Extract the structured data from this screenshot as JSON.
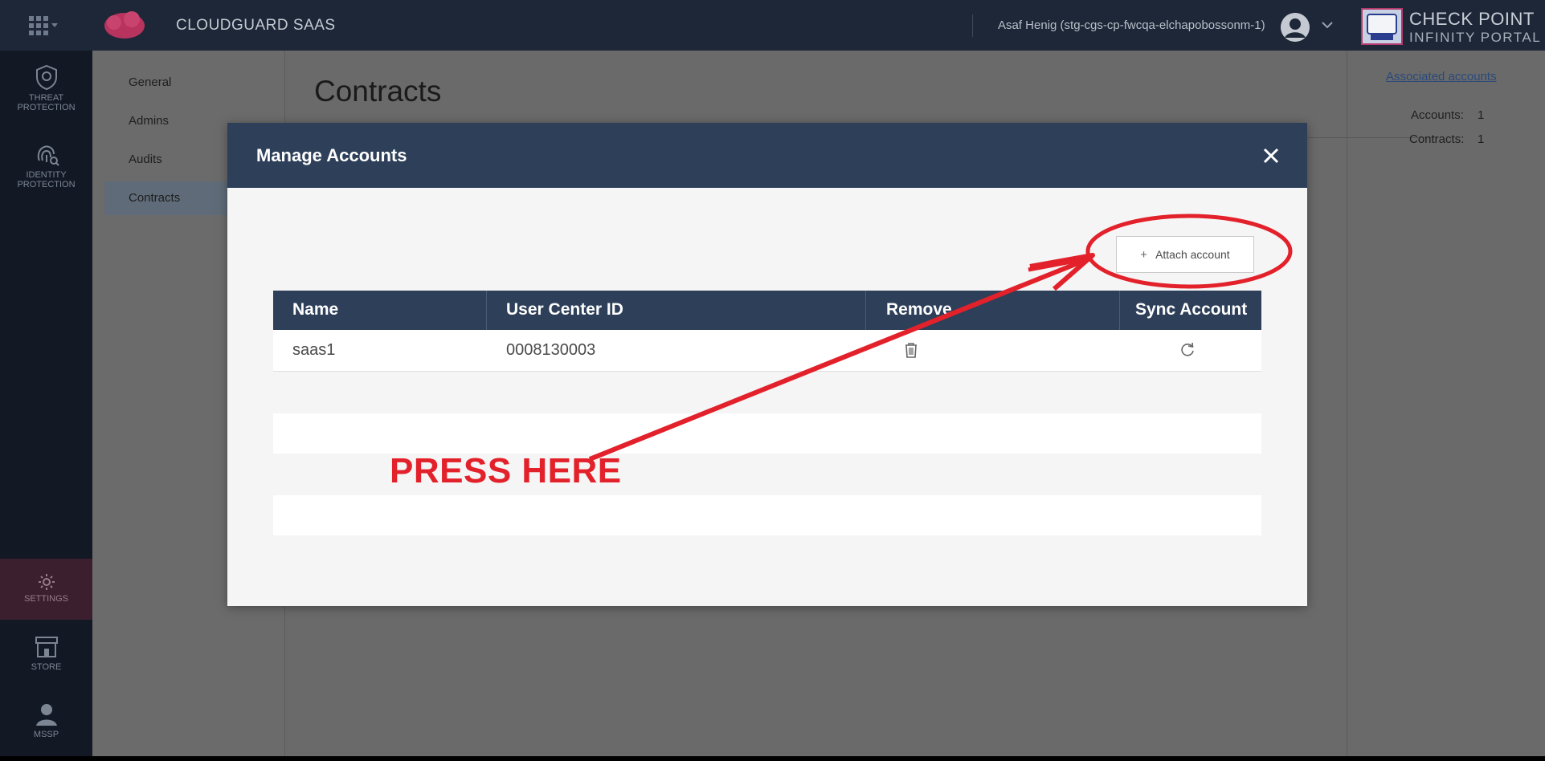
{
  "topbar": {
    "app_title": "CLOUDGUARD SAAS",
    "user_name": "Asaf Henig (stg-cgs-cp-fwcqa-elchapobossonm-1)",
    "brand_line1": "CHECK POINT",
    "brand_line2": "INFINITY PORTAL",
    "icons": [
      "apps-grid-icon",
      "cloudguard-saas-logo",
      "user-avatar-icon",
      "chevron-down-icon",
      "check-point-logo"
    ]
  },
  "leftnav": {
    "items": [
      {
        "label_line1": "THREAT",
        "label_line2": "PROTECTION",
        "icon": "shield-icon"
      },
      {
        "label_line1": "IDENTITY",
        "label_line2": "PROTECTION",
        "icon": "fingerprint-icon"
      },
      {
        "label_line1": "SETTINGS",
        "label_line2": "",
        "icon": "gear-icon"
      },
      {
        "label_line1": "STORE",
        "label_line2": "",
        "icon": "store-icon"
      },
      {
        "label_line1": "MSSP",
        "label_line2": "",
        "icon": "person-icon"
      }
    ]
  },
  "subnav": {
    "items": [
      "General",
      "Admins",
      "Audits",
      "Contracts"
    ],
    "active": "Contracts"
  },
  "page": {
    "title": "Contracts",
    "associated_link": "Associated accounts",
    "accounts_label": "Accounts:",
    "accounts_value": "1",
    "contracts_label": "Contracts:",
    "contracts_value": "1"
  },
  "modal": {
    "title": "Manage Accounts",
    "attach_label": "Attach account",
    "columns": [
      "Name",
      "User Center ID",
      "Remove",
      "Sync Account"
    ],
    "rows": [
      {
        "name": "saas1",
        "user_center_id": "0008130003"
      }
    ]
  },
  "annotation": {
    "text": "PRESS HERE",
    "color": "#e3212b"
  },
  "colors": {
    "topbar": "#1d2738",
    "leftnav": "#121925",
    "modal_header": "#2e3f59",
    "overlay_content": "#6a6a6a"
  }
}
